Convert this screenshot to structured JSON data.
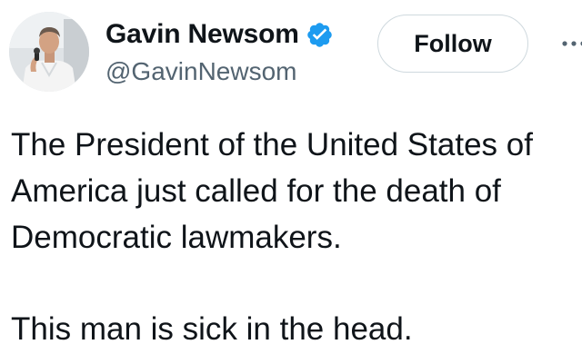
{
  "author": {
    "display_name": "Gavin Newsom",
    "handle": "@GavinNewsom",
    "verified_icon": "verified-badge-icon",
    "avatar_icon": "profile-photo"
  },
  "actions": {
    "follow_label": "Follow",
    "more_icon": "more-options-icon"
  },
  "tweet": {
    "lines": [
      "The President of the United States of",
      "America just called for the death of",
      "Democratic lawmakers."
    ],
    "second_paragraph": "This man is sick in the head."
  },
  "colors": {
    "text": "#0f1419",
    "secondary_text": "#536471",
    "verified_blue": "#1d9bf0",
    "button_border": "#cfd9de",
    "background": "#ffffff"
  }
}
